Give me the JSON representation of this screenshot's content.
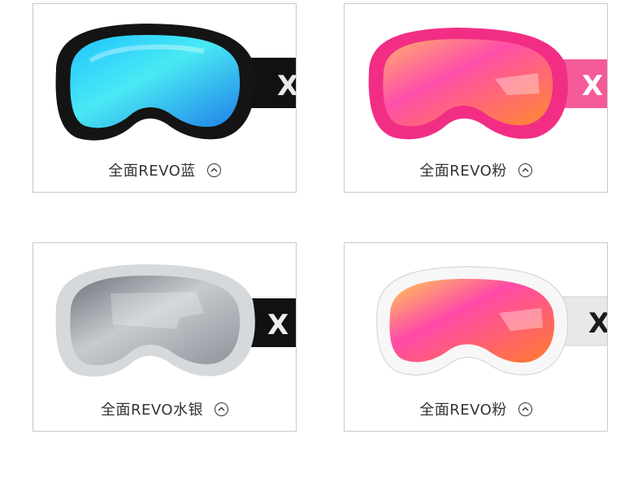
{
  "products": [
    {
      "label": "全面REVO蓝",
      "frame": "#141414",
      "strap": "#111111",
      "strap_text": "X",
      "lens_a": "#1fc3ff",
      "lens_b": "#49e9f4",
      "lens_c": "#1f7fe8",
      "strap_mark": "#e8e8e8"
    },
    {
      "label": "全面REVO粉",
      "frame": "#f22e84",
      "strap": "#f55a99",
      "strap_text": "X",
      "lens_a": "#ff8a2e",
      "lens_b": "#ff4fa8",
      "lens_c": "#ffb06a",
      "strap_mark": "#ffffff"
    },
    {
      "label": "全面REVO水银",
      "frame": "#d6d9dc",
      "strap": "#111111",
      "strap_text": "X",
      "lens_a": "#8d949a",
      "lens_b": "#c6cbcf",
      "lens_c": "#6c737a",
      "strap_mark": "#eeeeee"
    },
    {
      "label": "全面REVO粉",
      "frame": "#f7f7f7",
      "strap": "#e8e8e8",
      "strap_text": "X",
      "lens_a": "#ff7c2d",
      "lens_b": "#ff4aa8",
      "lens_c": "#ffcf52",
      "strap_mark": "#1a1a1a"
    }
  ]
}
